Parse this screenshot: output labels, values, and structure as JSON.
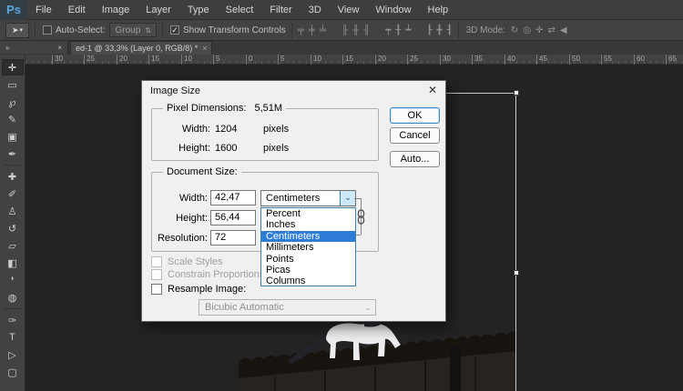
{
  "colors": {
    "chrome_dark": "#424242",
    "canvas": "#232323",
    "dialog_bg": "#f0f0f0",
    "highlight_blue": "#2f7cd6",
    "combo_chevron_bg": "#cfe8f8",
    "sky_top": "#53779c",
    "sky_bottom": "#8fb6dd"
  },
  "menu": {
    "logo": "Ps",
    "items": [
      "File",
      "Edit",
      "Image",
      "Layer",
      "Type",
      "Select",
      "Filter",
      "3D",
      "View",
      "Window",
      "Help"
    ]
  },
  "icons": {
    "move_tool": "➤",
    "caret_down": "▾",
    "check": "✓",
    "stepper": "⇅",
    "chevron_down": "⌄",
    "double_chevron": "»",
    "panel_close": "×",
    "dialog_close": "✕"
  },
  "options_bar": {
    "auto_select_label": "Auto-Select:",
    "group_value": "Group",
    "show_transform_label": "Show Transform Controls",
    "mode_label": "3D Mode:",
    "align_icons": [
      {
        "name": "align-top-edges",
        "glyph": "╤"
      },
      {
        "name": "align-vertical-centers",
        "glyph": "╪"
      },
      {
        "name": "align-bottom-edges",
        "glyph": "╧"
      },
      {
        "name": "align-left-edges",
        "glyph": "╟"
      },
      {
        "name": "align-horizontal-centers",
        "glyph": "╫"
      },
      {
        "name": "align-right-edges",
        "glyph": "╢"
      },
      {
        "name": "distribute-top-edges",
        "glyph": "┯"
      },
      {
        "name": "distribute-vertical-centers",
        "glyph": "╂"
      },
      {
        "name": "distribute-bottom-edges",
        "glyph": "┷"
      },
      {
        "name": "distribute-left-edges",
        "glyph": "┠"
      },
      {
        "name": "distribute-horizontal-centers",
        "glyph": "╋"
      },
      {
        "name": "distribute-right-edges",
        "glyph": "┨"
      }
    ],
    "mode_icons": [
      {
        "name": "3d-orbit",
        "glyph": "↻"
      },
      {
        "name": "3d-roll",
        "glyph": "◎"
      },
      {
        "name": "3d-pan",
        "glyph": "✛"
      },
      {
        "name": "3d-slide",
        "glyph": "⇄"
      },
      {
        "name": "3d-camera",
        "glyph": "◀"
      }
    ]
  },
  "document_tab": {
    "title": "ed-1 @ 33,3% (Layer 0, RGB/8) *",
    "close": "×"
  },
  "ruler": {
    "labels": [
      "30",
      "25",
      "20",
      "15",
      "10",
      "5",
      "0",
      "5",
      "10",
      "15",
      "20",
      "25",
      "30",
      "35",
      "40",
      "45",
      "50",
      "55",
      "60",
      "65"
    ]
  },
  "tools": [
    {
      "name": "move-tool",
      "glyph": "✛"
    },
    {
      "name": "marquee-tool",
      "glyph": "▭"
    },
    {
      "name": "lasso-tool",
      "glyph": "℘"
    },
    {
      "name": "quick-selection-tool",
      "glyph": "✎"
    },
    {
      "name": "crop-tool",
      "glyph": "▣"
    },
    {
      "name": "eyedropper-tool",
      "glyph": "✒"
    },
    {
      "name": "healing-brush-tool",
      "glyph": "✚"
    },
    {
      "name": "brush-tool",
      "glyph": "✐"
    },
    {
      "name": "clone-stamp-tool",
      "glyph": "♙"
    },
    {
      "name": "history-brush-tool",
      "glyph": "↺"
    },
    {
      "name": "eraser-tool",
      "glyph": "▱"
    },
    {
      "name": "gradient-tool",
      "glyph": "◧"
    },
    {
      "name": "blur-tool",
      "glyph": "❛"
    },
    {
      "name": "sponge-tool",
      "glyph": "◍"
    },
    {
      "name": "pen-tool",
      "glyph": "✑"
    },
    {
      "name": "type-tool",
      "glyph": "T"
    },
    {
      "name": "path-selection-tool",
      "glyph": "▷"
    },
    {
      "name": "shape-tool",
      "glyph": "▢"
    }
  ],
  "dialog": {
    "title": "Image Size",
    "pixel_dimensions": {
      "legend": "Pixel Dimensions:",
      "size": "5,51M",
      "width_label": "Width:",
      "width_value": "1204",
      "width_unit": "pixels",
      "height_label": "Height:",
      "height_value": "1600",
      "height_unit": "pixels"
    },
    "buttons": {
      "ok": "OK",
      "cancel": "Cancel",
      "auto": "Auto..."
    },
    "document_size": {
      "legend": "Document Size:",
      "width_label": "Width:",
      "width_value": "42,47",
      "height_label": "Height:",
      "height_value": "56,44",
      "resolution_label": "Resolution:",
      "resolution_value": "72",
      "unit_selected": "Centimeters"
    },
    "unit_options": [
      "Percent",
      "Inches",
      "Centimeters",
      "Millimeters",
      "Points",
      "Picas",
      "Columns"
    ],
    "checkboxes": {
      "scale_styles": "Scale Styles",
      "constrain": "Constrain Proportions",
      "resample": "Resample Image:"
    },
    "resample_method": "Bicubic Automatic"
  }
}
